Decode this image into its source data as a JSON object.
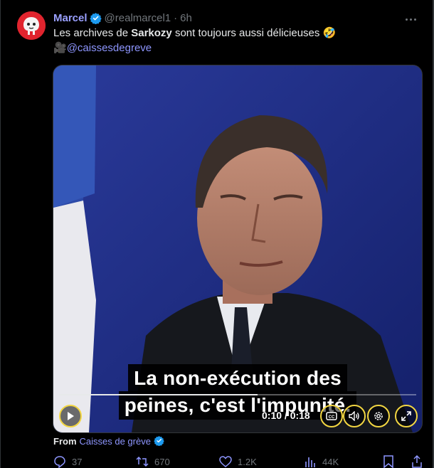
{
  "tweet": {
    "author_name": "Marcel",
    "author_handle": "@realmarcel1",
    "separator": "·",
    "time": "6h",
    "text_prefix": "Les archives de ",
    "text_bold": "Sarkozy",
    "text_suffix": " sont toujours aussi délicieuses 🤣",
    "line2_emoji": "🎥",
    "line2_mention": "@caissesdegreve",
    "verified_color": "#1d9bf0"
  },
  "video": {
    "subtitle_line1": "La non-exécution des",
    "subtitle_line2": "peines, c'est l'impunité.",
    "timecode": "0:10 / 0:18",
    "progress": 0.5556,
    "controls": {
      "play": "play-icon",
      "captions": "captions-icon",
      "volume": "volume-icon",
      "settings": "gear-icon",
      "fullscreen": "expand-icon"
    },
    "accent_color": "#f2d642"
  },
  "attribution": {
    "label": "From",
    "source": "Caisses de grève"
  },
  "actions": {
    "replies": "37",
    "retweets": "670",
    "likes": "1.2K",
    "views": "44K"
  }
}
